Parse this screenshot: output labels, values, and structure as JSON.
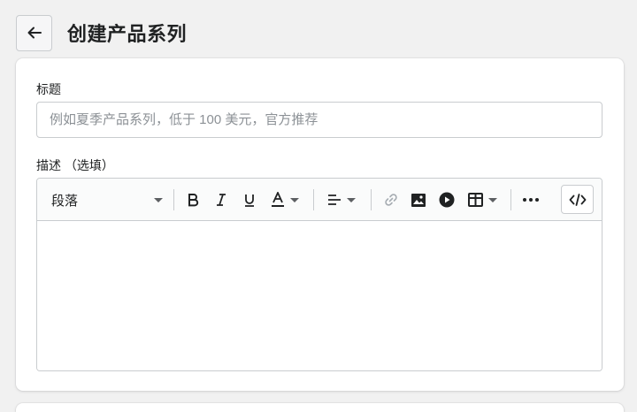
{
  "header": {
    "back_icon": "arrow-left-icon",
    "title": "创建产品系列"
  },
  "form": {
    "title_label": "标题",
    "title_placeholder": "例如夏季产品系列，低于 100 美元，官方推荐",
    "title_value": "",
    "description_label": "描述 （选填）"
  },
  "editor": {
    "paragraph_select": "段落",
    "toolbar_icons": [
      "bold-icon",
      "italic-icon",
      "underline-icon",
      "text-color-icon",
      "align-icon",
      "link-icon",
      "image-icon",
      "video-icon",
      "table-icon",
      "more-icon",
      "code-view-icon"
    ],
    "bold_glyph": "B",
    "italic_glyph": "I",
    "underline_glyph": "U",
    "color_glyph": "A",
    "body_text": ""
  },
  "colors": {
    "background": "#f1f1f1",
    "card": "#ffffff",
    "border": "#c9cccf",
    "link_disabled": "#a6acb2"
  }
}
